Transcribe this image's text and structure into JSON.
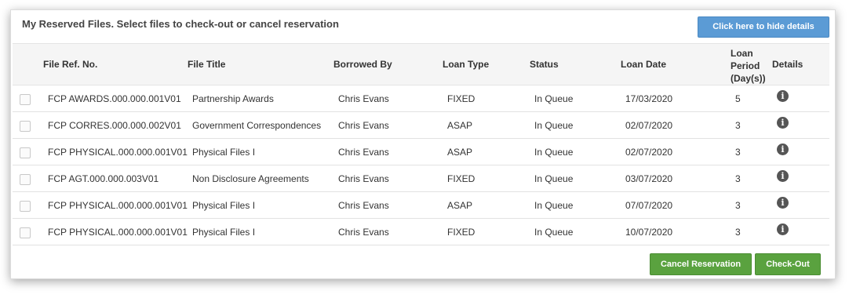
{
  "panel": {
    "title": "My Reserved Files. Select files to check-out or cancel reservation",
    "hide_details_label": "Click here to hide details"
  },
  "columns": {
    "ref": "File Ref. No.",
    "title": "File Title",
    "borrowed_by": "Borrowed By",
    "loan_type": "Loan Type",
    "status": "Status",
    "loan_date": "Loan Date",
    "loan_period_line1": "Loan",
    "loan_period_line2": "Period",
    "loan_period_line3": "(Day(s))",
    "details": "Details"
  },
  "rows": [
    {
      "ref": "FCP AWARDS.000.000.001V01",
      "title": "Partnership Awards",
      "by": "Chris Evans",
      "type": "FIXED",
      "status": "In Queue",
      "date": "17/03/2020",
      "period": "5"
    },
    {
      "ref": "FCP CORRES.000.000.002V01",
      "title": "Government Correspondences",
      "by": "Chris Evans",
      "type": "ASAP",
      "status": "In Queue",
      "date": "02/07/2020",
      "period": "3"
    },
    {
      "ref": "FCP PHYSICAL.000.000.001V01",
      "title": "Physical Files I",
      "by": "Chris Evans",
      "type": "ASAP",
      "status": "In Queue",
      "date": "02/07/2020",
      "period": "3"
    },
    {
      "ref": "FCP AGT.000.000.003V01",
      "title": "Non Disclosure Agreements",
      "by": "Chris Evans",
      "type": "FIXED",
      "status": "In Queue",
      "date": "03/07/2020",
      "period": "3"
    },
    {
      "ref": "FCP PHYSICAL.000.000.001V01",
      "title": "Physical Files I",
      "by": "Chris Evans",
      "type": "ASAP",
      "status": "In Queue",
      "date": "07/07/2020",
      "period": "3"
    },
    {
      "ref": "FCP PHYSICAL.000.000.001V01",
      "title": "Physical Files I",
      "by": "Chris Evans",
      "type": "FIXED",
      "status": "In Queue",
      "date": "10/07/2020",
      "period": "3"
    }
  ],
  "actions": {
    "cancel_label": "Cancel Reservation",
    "checkout_label": "Check-Out"
  },
  "icons": {
    "details_icon": "info-circle-icon",
    "checkbox": "checkbox"
  },
  "colors": {
    "hide_button": "#5b9bd5",
    "action_buttons": "#5aa23f"
  }
}
